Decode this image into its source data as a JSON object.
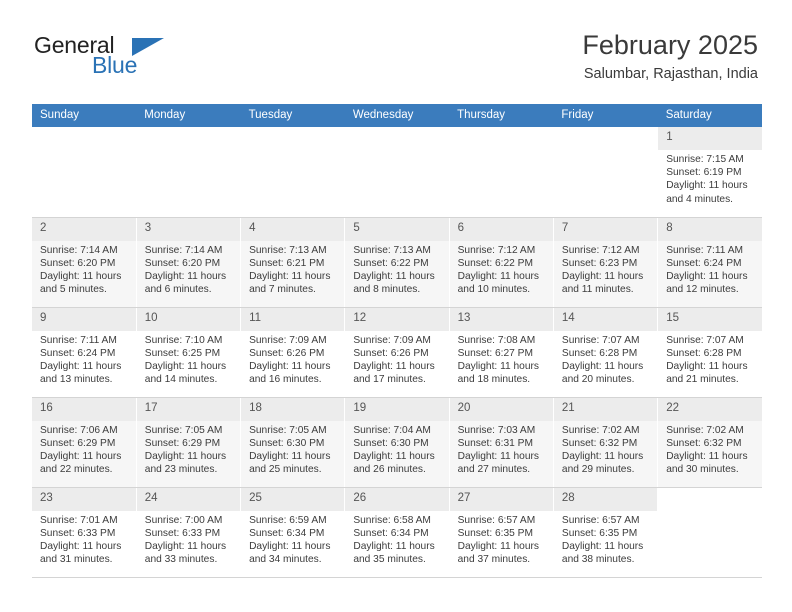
{
  "brand": {
    "name_part1": "General",
    "name_part2": "Blue",
    "accent_color": "#2a72b5"
  },
  "header": {
    "title": "February 2025",
    "location": "Salumbar, Rajasthan, India"
  },
  "calendar": {
    "header_bg": "#3b7cbd",
    "weekdays": [
      "Sunday",
      "Monday",
      "Tuesday",
      "Wednesday",
      "Thursday",
      "Friday",
      "Saturday"
    ],
    "weeks": [
      [
        {
          "day": "",
          "lines": []
        },
        {
          "day": "",
          "lines": []
        },
        {
          "day": "",
          "lines": []
        },
        {
          "day": "",
          "lines": []
        },
        {
          "day": "",
          "lines": []
        },
        {
          "day": "",
          "lines": []
        },
        {
          "day": "1",
          "lines": [
            "Sunrise: 7:15 AM",
            "Sunset: 6:19 PM",
            "Daylight: 11 hours",
            "and 4 minutes."
          ]
        }
      ],
      [
        {
          "day": "2",
          "lines": [
            "Sunrise: 7:14 AM",
            "Sunset: 6:20 PM",
            "Daylight: 11 hours",
            "and 5 minutes."
          ]
        },
        {
          "day": "3",
          "lines": [
            "Sunrise: 7:14 AM",
            "Sunset: 6:20 PM",
            "Daylight: 11 hours",
            "and 6 minutes."
          ]
        },
        {
          "day": "4",
          "lines": [
            "Sunrise: 7:13 AM",
            "Sunset: 6:21 PM",
            "Daylight: 11 hours",
            "and 7 minutes."
          ]
        },
        {
          "day": "5",
          "lines": [
            "Sunrise: 7:13 AM",
            "Sunset: 6:22 PM",
            "Daylight: 11 hours",
            "and 8 minutes."
          ]
        },
        {
          "day": "6",
          "lines": [
            "Sunrise: 7:12 AM",
            "Sunset: 6:22 PM",
            "Daylight: 11 hours",
            "and 10 minutes."
          ]
        },
        {
          "day": "7",
          "lines": [
            "Sunrise: 7:12 AM",
            "Sunset: 6:23 PM",
            "Daylight: 11 hours",
            "and 11 minutes."
          ]
        },
        {
          "day": "8",
          "lines": [
            "Sunrise: 7:11 AM",
            "Sunset: 6:24 PM",
            "Daylight: 11 hours",
            "and 12 minutes."
          ]
        }
      ],
      [
        {
          "day": "9",
          "lines": [
            "Sunrise: 7:11 AM",
            "Sunset: 6:24 PM",
            "Daylight: 11 hours",
            "and 13 minutes."
          ]
        },
        {
          "day": "10",
          "lines": [
            "Sunrise: 7:10 AM",
            "Sunset: 6:25 PM",
            "Daylight: 11 hours",
            "and 14 minutes."
          ]
        },
        {
          "day": "11",
          "lines": [
            "Sunrise: 7:09 AM",
            "Sunset: 6:26 PM",
            "Daylight: 11 hours",
            "and 16 minutes."
          ]
        },
        {
          "day": "12",
          "lines": [
            "Sunrise: 7:09 AM",
            "Sunset: 6:26 PM",
            "Daylight: 11 hours",
            "and 17 minutes."
          ]
        },
        {
          "day": "13",
          "lines": [
            "Sunrise: 7:08 AM",
            "Sunset: 6:27 PM",
            "Daylight: 11 hours",
            "and 18 minutes."
          ]
        },
        {
          "day": "14",
          "lines": [
            "Sunrise: 7:07 AM",
            "Sunset: 6:28 PM",
            "Daylight: 11 hours",
            "and 20 minutes."
          ]
        },
        {
          "day": "15",
          "lines": [
            "Sunrise: 7:07 AM",
            "Sunset: 6:28 PM",
            "Daylight: 11 hours",
            "and 21 minutes."
          ]
        }
      ],
      [
        {
          "day": "16",
          "lines": [
            "Sunrise: 7:06 AM",
            "Sunset: 6:29 PM",
            "Daylight: 11 hours",
            "and 22 minutes."
          ]
        },
        {
          "day": "17",
          "lines": [
            "Sunrise: 7:05 AM",
            "Sunset: 6:29 PM",
            "Daylight: 11 hours",
            "and 23 minutes."
          ]
        },
        {
          "day": "18",
          "lines": [
            "Sunrise: 7:05 AM",
            "Sunset: 6:30 PM",
            "Daylight: 11 hours",
            "and 25 minutes."
          ]
        },
        {
          "day": "19",
          "lines": [
            "Sunrise: 7:04 AM",
            "Sunset: 6:30 PM",
            "Daylight: 11 hours",
            "and 26 minutes."
          ]
        },
        {
          "day": "20",
          "lines": [
            "Sunrise: 7:03 AM",
            "Sunset: 6:31 PM",
            "Daylight: 11 hours",
            "and 27 minutes."
          ]
        },
        {
          "day": "21",
          "lines": [
            "Sunrise: 7:02 AM",
            "Sunset: 6:32 PM",
            "Daylight: 11 hours",
            "and 29 minutes."
          ]
        },
        {
          "day": "22",
          "lines": [
            "Sunrise: 7:02 AM",
            "Sunset: 6:32 PM",
            "Daylight: 11 hours",
            "and 30 minutes."
          ]
        }
      ],
      [
        {
          "day": "23",
          "lines": [
            "Sunrise: 7:01 AM",
            "Sunset: 6:33 PM",
            "Daylight: 11 hours",
            "and 31 minutes."
          ]
        },
        {
          "day": "24",
          "lines": [
            "Sunrise: 7:00 AM",
            "Sunset: 6:33 PM",
            "Daylight: 11 hours",
            "and 33 minutes."
          ]
        },
        {
          "day": "25",
          "lines": [
            "Sunrise: 6:59 AM",
            "Sunset: 6:34 PM",
            "Daylight: 11 hours",
            "and 34 minutes."
          ]
        },
        {
          "day": "26",
          "lines": [
            "Sunrise: 6:58 AM",
            "Sunset: 6:34 PM",
            "Daylight: 11 hours",
            "and 35 minutes."
          ]
        },
        {
          "day": "27",
          "lines": [
            "Sunrise: 6:57 AM",
            "Sunset: 6:35 PM",
            "Daylight: 11 hours",
            "and 37 minutes."
          ]
        },
        {
          "day": "28",
          "lines": [
            "Sunrise: 6:57 AM",
            "Sunset: 6:35 PM",
            "Daylight: 11 hours",
            "and 38 minutes."
          ]
        },
        {
          "day": "",
          "lines": []
        }
      ]
    ]
  }
}
